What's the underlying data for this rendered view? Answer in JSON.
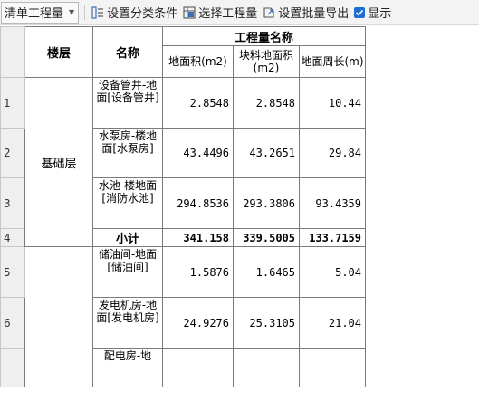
{
  "toolbar": {
    "dropdown_label": "清单工程量",
    "btn_category": "设置分类条件",
    "btn_quantity": "选择工程量",
    "btn_export": "设置批量导出",
    "check_label": "显示"
  },
  "table": {
    "headers": {
      "floor": "楼层",
      "name": "名称",
      "group": "工程量名称",
      "col1": "地面积(m2)",
      "col2": "块料地面积(m2)",
      "col3": "地面周长(m)"
    },
    "groups": [
      {
        "floor": "基础层",
        "rows": [
          {
            "no": "1",
            "name": "设备管井-地面[设备管井]",
            "v1": "2.8548",
            "v2": "2.8548",
            "v3": "10.44"
          },
          {
            "no": "2",
            "name": "水泵房-楼地面[水泵房]",
            "v1": "43.4496",
            "v2": "43.2651",
            "v3": "29.84"
          },
          {
            "no": "3",
            "name": "水池-楼地面[消防水池]",
            "v1": "294.8536",
            "v2": "293.3806",
            "v3": "93.4359"
          }
        ],
        "subtotal": {
          "no": "4",
          "label": "小计",
          "v1": "341.158",
          "v2": "339.5005",
          "v3": "133.7159"
        }
      },
      {
        "floor": "",
        "rows": [
          {
            "no": "5",
            "name": "储油间-地面[储油间]",
            "v1": "1.5876",
            "v2": "1.6465",
            "v3": "5.04"
          },
          {
            "no": "6",
            "name": "发电机房-地面[发电机房]",
            "v1": "24.9276",
            "v2": "25.3105",
            "v3": "21.04"
          },
          {
            "no": "",
            "name": "配电房-地",
            "v1": "",
            "v2": "",
            "v3": ""
          }
        ]
      }
    ]
  }
}
